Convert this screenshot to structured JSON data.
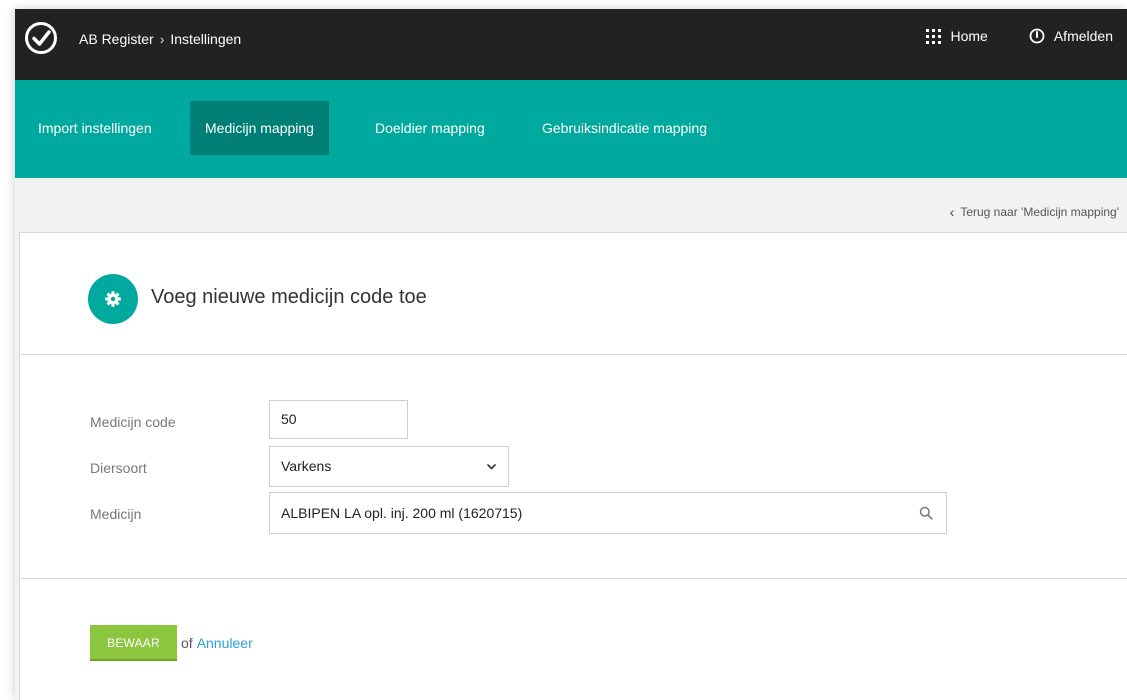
{
  "header": {
    "breadcrumb": [
      "AB Register",
      "Instellingen"
    ],
    "separator": "›",
    "home_label": "Home",
    "logout_label": "Afmelden"
  },
  "tabs": [
    {
      "label": "Import instellingen",
      "active": false
    },
    {
      "label": "Medicijn mapping",
      "active": true
    },
    {
      "label": "Doeldier mapping",
      "active": false
    },
    {
      "label": "Gebruiksindicatie mapping",
      "active": false
    }
  ],
  "back_link": "Terug naar 'Medicijn mapping'",
  "card": {
    "title": "Voeg nieuwe medicijn code toe"
  },
  "form": {
    "code_label": "Medicijn code",
    "code_value": "50",
    "species_label": "Diersoort",
    "species_value": "Varkens",
    "medicine_label": "Medicijn",
    "medicine_value": "ALBIPEN LA opl. inj. 200 ml (1620715)"
  },
  "actions": {
    "save_label": "BEWAAR",
    "or_text": "of",
    "cancel_label": "Annuleer"
  },
  "colors": {
    "topbar": "#222222",
    "teal": "#00a99d",
    "teal_dark": "#007f76",
    "green": "#8cc63f",
    "link": "#2a9fd6"
  },
  "icons": {
    "logo": "check-circle-icon",
    "home": "grid-icon",
    "logout": "power-icon",
    "back": "chevron-left-icon",
    "header": "gear-icon",
    "select": "chevron-down-icon",
    "search": "search-icon"
  }
}
